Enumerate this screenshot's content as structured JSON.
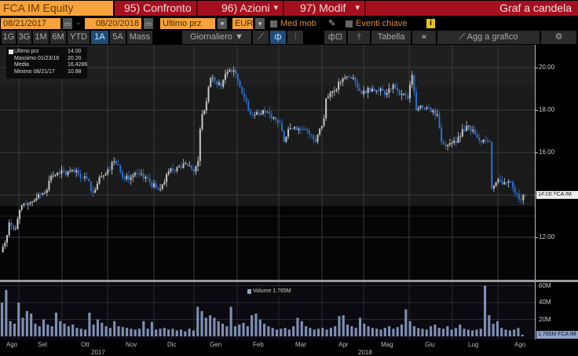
{
  "header": {
    "ticker": "FCA IM Equity",
    "compare": "95) Confronto",
    "actions": "96) Azioni",
    "edit": "97) Modif",
    "title": "Graf a candela",
    "dropdown_glyph": "▾"
  },
  "controls": {
    "start_date": "08/21/2017",
    "dash": "-",
    "end_date": "08/20/2018",
    "field": "Ultimo prz",
    "currency": "EUR",
    "moving_avg": "Med mob",
    "key_events": "Eventi chiave",
    "info": "i"
  },
  "toolbar": {
    "ranges": [
      "1G",
      "3G",
      "1M",
      "6M",
      "YTD",
      "1A",
      "5A",
      "Mass"
    ],
    "selected": "1A",
    "period": "Giornaliero ▼",
    "table": "Tabella",
    "collapse": "«",
    "add_to_chart": "Agg a grafico",
    "settings": "⚙"
  },
  "legend": {
    "last_label": "Ultimo prz",
    "last": "14.00",
    "high_label": "Massimo 01/23/18",
    "high": "20.20",
    "mean_label": "Media",
    "mean": "16.4286",
    "low_label": "Minimo 08/21/17",
    "low": "10.88"
  },
  "volume_legend": "Volume 1.765M",
  "price_tag": "14.00 FCA IM",
  "volume_tag": "1.765M FCA IM",
  "colors": {
    "up": "#c8c8c8",
    "down": "#2f6fd0",
    "accent": "#f7a23a",
    "red": "#a5101f"
  },
  "chart_data": {
    "type": "candlestick",
    "title": "Graf a candela",
    "ylim": [
      10.3,
      21.0
    ],
    "yticks": [
      "12.00",
      "14.00",
      "16.00",
      "18.00",
      "20.00"
    ],
    "vticks": [
      "20M",
      "40M",
      "60M"
    ],
    "vlim": [
      0,
      66
    ],
    "xmonths": [
      "Ago",
      "Set",
      "Ott",
      "Nov",
      "Dic",
      "Gen",
      "Feb",
      "Mar",
      "Apr",
      "Mag",
      "Giu",
      "Lug",
      "Ago"
    ],
    "years": [
      "2017",
      "2018"
    ],
    "days_total": 250,
    "closes": [
      [
        0,
        11.3
      ],
      [
        3,
        12.1
      ],
      [
        4,
        12.7
      ],
      [
        7,
        12.4
      ],
      [
        9,
        13.3
      ],
      [
        13,
        13.6
      ],
      [
        17,
        13.85
      ],
      [
        21,
        14.1
      ],
      [
        24,
        14.9
      ],
      [
        28,
        15.0
      ],
      [
        32,
        15.1
      ],
      [
        37,
        15.0
      ],
      [
        41,
        14.75
      ],
      [
        44,
        14.1
      ],
      [
        47,
        14.85
      ],
      [
        51,
        15.2
      ],
      [
        54,
        15.6
      ],
      [
        56,
        15.4
      ],
      [
        59,
        14.75
      ],
      [
        62,
        14.85
      ],
      [
        67,
        15.0
      ],
      [
        71,
        14.6
      ],
      [
        74,
        14.3
      ],
      [
        77,
        14.5
      ],
      [
        80,
        15.1
      ],
      [
        84,
        15.3
      ],
      [
        88,
        15.5
      ],
      [
        92,
        15.1
      ],
      [
        94,
        15.6
      ],
      [
        95,
        17.1
      ],
      [
        96,
        17.8
      ],
      [
        98,
        18.4
      ],
      [
        100,
        19.5
      ],
      [
        103,
        19.2
      ],
      [
        105,
        19.1
      ],
      [
        107,
        19.7
      ],
      [
        109,
        19.9
      ],
      [
        110,
        19.8
      ],
      [
        112,
        19.7
      ],
      [
        114,
        19.1
      ],
      [
        117,
        18.4
      ],
      [
        119,
        17.8
      ],
      [
        122,
        17.9
      ],
      [
        125,
        18.0
      ],
      [
        129,
        17.6
      ],
      [
        133,
        17.4
      ],
      [
        135,
        16.5
      ],
      [
        137,
        17.1
      ],
      [
        140,
        17.2
      ],
      [
        144,
        17.1
      ],
      [
        148,
        16.8
      ],
      [
        150,
        16.5
      ],
      [
        154,
        17.6
      ],
      [
        155,
        18.55
      ],
      [
        159,
        18.9
      ],
      [
        163,
        19.5
      ],
      [
        166,
        19.55
      ],
      [
        169,
        19.3
      ],
      [
        172,
        18.75
      ],
      [
        175,
        19.05
      ],
      [
        180,
        18.9
      ],
      [
        184,
        18.8
      ],
      [
        187,
        19.2
      ],
      [
        191,
        18.75
      ],
      [
        194,
        18.55
      ],
      [
        196,
        19.65
      ],
      [
        198,
        18.0
      ],
      [
        200,
        18.2
      ],
      [
        204,
        18.1
      ],
      [
        208,
        17.8
      ],
      [
        210,
        16.5
      ],
      [
        213,
        16.35
      ],
      [
        217,
        16.45
      ],
      [
        220,
        17.1
      ],
      [
        223,
        17.25
      ],
      [
        227,
        16.7
      ],
      [
        230,
        16.6
      ],
      [
        233,
        16.5
      ],
      [
        234,
        14.3
      ],
      [
        236,
        14.6
      ],
      [
        240,
        14.6
      ],
      [
        243,
        14.6
      ],
      [
        245,
        14.1
      ],
      [
        248,
        13.75
      ],
      [
        250,
        14.0
      ]
    ],
    "volumes_m": [
      40,
      55,
      18,
      15,
      40,
      22,
      30,
      27,
      15,
      12,
      20,
      14,
      12,
      28,
      18,
      15,
      12,
      14,
      10,
      9,
      8,
      28,
      14,
      20,
      16,
      12,
      10,
      18,
      12,
      11,
      10,
      9,
      8,
      9,
      18,
      9,
      17,
      8,
      9,
      10,
      8,
      9,
      7,
      8,
      6,
      9,
      7,
      35,
      30,
      22,
      25,
      22,
      18,
      15,
      12,
      35,
      12,
      14,
      16,
      12,
      25,
      27,
      20,
      15,
      12,
      10,
      8,
      9,
      10,
      8,
      12,
      22,
      18,
      12,
      10,
      8,
      9,
      10,
      8,
      10,
      12,
      24,
      25,
      14,
      12,
      10,
      22,
      15,
      12,
      10,
      9,
      8,
      10,
      12,
      9,
      11,
      14,
      32,
      18,
      12,
      10,
      9,
      8,
      12,
      14,
      10,
      9,
      12,
      8,
      10,
      14,
      9,
      8,
      7,
      8,
      9,
      60,
      25,
      15,
      18,
      10,
      8,
      7,
      8,
      10,
      2
    ]
  }
}
